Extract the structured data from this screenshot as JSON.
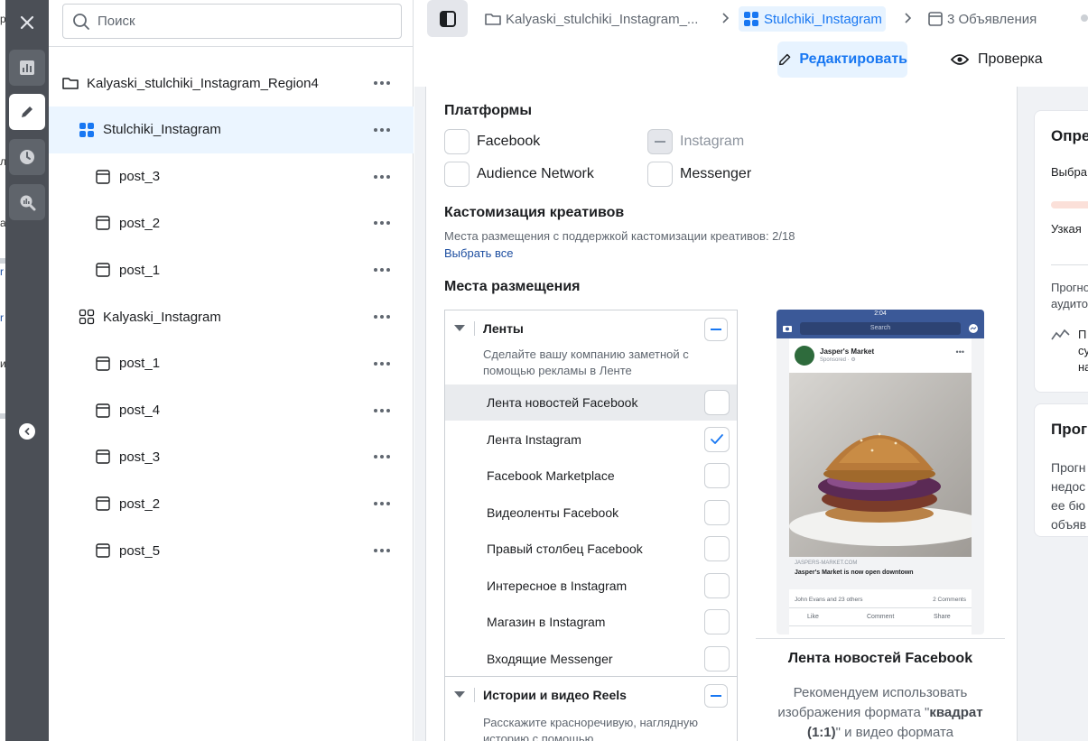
{
  "search": {
    "placeholder": "Поиск"
  },
  "tree": {
    "items": [
      {
        "label": "Kalyaski_stulchiki_Instagram_Region4",
        "level": 0,
        "kind": "campaign"
      },
      {
        "label": "Stulchiki_Instagram",
        "level": 1,
        "kind": "adset",
        "selected": true
      },
      {
        "label": "post_3",
        "level": 2,
        "kind": "ad"
      },
      {
        "label": "post_2",
        "level": 2,
        "kind": "ad"
      },
      {
        "label": "post_1",
        "level": 2,
        "kind": "ad"
      },
      {
        "label": "Kalyaski_Instagram",
        "level": 1,
        "kind": "adset-outline"
      },
      {
        "label": "post_1",
        "level": 2,
        "kind": "ad"
      },
      {
        "label": "post_4",
        "level": 2,
        "kind": "ad"
      },
      {
        "label": "post_3",
        "level": 2,
        "kind": "ad"
      },
      {
        "label": "post_2",
        "level": 2,
        "kind": "ad"
      },
      {
        "label": "post_5",
        "level": 2,
        "kind": "ad"
      }
    ]
  },
  "breadcrumbs": {
    "campaign": "Kalyaski_stulchiki_Instagram_...",
    "adset": "Stulchiki_Instagram",
    "ads": "3 Объявления"
  },
  "actions": {
    "edit": "Редактировать",
    "review": "Проверка"
  },
  "platforms": {
    "title": "Платформы",
    "facebook": "Facebook",
    "instagram": "Instagram",
    "audience_network": "Audience Network",
    "messenger": "Messenger"
  },
  "customization": {
    "title": "Кастомизация креативов",
    "note": "Места размещения с поддержкой кастомизации креативов: 2/18",
    "select_all": "Выбрать все"
  },
  "placements": {
    "title": "Места размещения",
    "groups": [
      {
        "title": "Ленты",
        "desc": "Сделайте вашу компанию заметной с помощью рекламы в Ленте",
        "items": [
          {
            "label": "Лента новостей Facebook",
            "checked": false,
            "highlight": true
          },
          {
            "label": "Лента Instagram",
            "checked": true
          },
          {
            "label": "Facebook Marketplace",
            "checked": false
          },
          {
            "label": "Видеоленты Facebook",
            "checked": false
          },
          {
            "label": "Правый столбец Facebook",
            "checked": false
          },
          {
            "label": "Интересное в Instagram",
            "checked": false
          },
          {
            "label": "Магазин в Instagram",
            "checked": false
          },
          {
            "label": "Входящие Messenger",
            "checked": false
          }
        ]
      },
      {
        "title": "Истории и видео Reels",
        "desc": "Расскажите красноречивую, наглядную историю с помощью"
      }
    ]
  },
  "preview": {
    "time": "2:04",
    "search": "Search",
    "page_name": "Jasper's Market",
    "sponsored": "Sponsored · ⚙",
    "domain": "JASPERS-MARKET.COM",
    "headline": "Jasper's Market is now open downtown",
    "reactions": "John Evans and 23 others",
    "comments": "2 Comments",
    "like": "Like",
    "comment": "Comment",
    "share": "Share",
    "caption": "Лента новостей Facebook",
    "rec_pre": "Рекомендуем использовать изображения формата \"",
    "rec_bold": "квадрат (1:1)",
    "rec_post": "\" и видео формата"
  },
  "right_cards": {
    "card1": {
      "title": "Опре",
      "line1": "Выбра",
      "line2": "Узкая",
      "line3": "Прогно",
      "line4": "аудито",
      "line5": "П",
      "line6": "су",
      "line7": "на"
    },
    "card2": {
      "title": "Прог",
      "line1": "Прогн",
      "line2": "недос",
      "line3": "ее бю",
      "line4": "объяв"
    }
  },
  "colors": {
    "accent": "#1877f2",
    "rail": "#4b4f56",
    "selected_row": "#ebf5ff",
    "canvas": "#f0f2f5"
  }
}
